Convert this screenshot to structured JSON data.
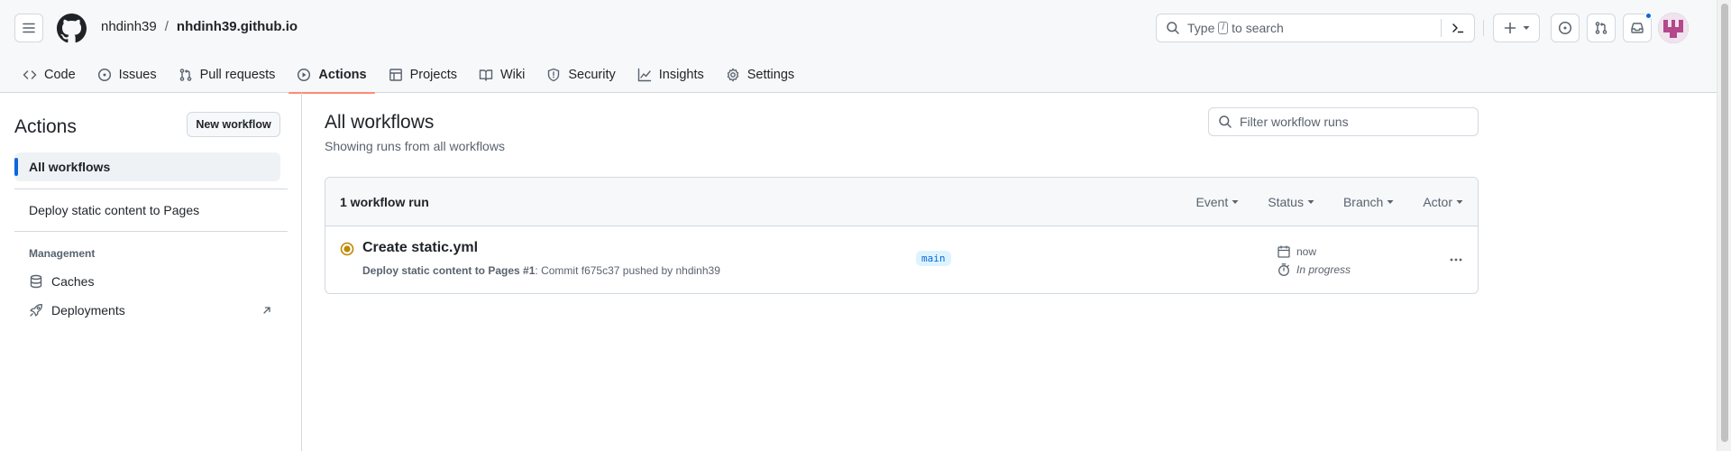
{
  "header": {
    "repo_owner": "nhdinh39",
    "repo_separator": "/",
    "repo_name": "nhdinh39.github.io",
    "search_prefix": "Type",
    "search_key": "/",
    "search_suffix": "to search"
  },
  "tabs": [
    {
      "label": "Code",
      "icon": "code-icon"
    },
    {
      "label": "Issues",
      "icon": "issue-opened-icon"
    },
    {
      "label": "Pull requests",
      "icon": "git-pull-request-icon"
    },
    {
      "label": "Actions",
      "icon": "play-icon",
      "active": true
    },
    {
      "label": "Projects",
      "icon": "table-icon"
    },
    {
      "label": "Wiki",
      "icon": "book-icon"
    },
    {
      "label": "Security",
      "icon": "shield-icon"
    },
    {
      "label": "Insights",
      "icon": "graph-icon"
    },
    {
      "label": "Settings",
      "icon": "gear-icon"
    }
  ],
  "sidebar": {
    "title": "Actions",
    "new_workflow": "New workflow",
    "items": [
      {
        "label": "All workflows",
        "active": true
      },
      {
        "label": "Deploy static content to Pages"
      }
    ],
    "management_heading": "Management",
    "links": [
      {
        "label": "Caches",
        "icon": "database-icon"
      },
      {
        "label": "Deployments",
        "icon": "rocket-icon",
        "external": true
      }
    ]
  },
  "main": {
    "title": "All workflows",
    "subtitle": "Showing runs from all workflows",
    "filter_placeholder": "Filter workflow runs",
    "runs_count": "1 workflow run",
    "filters": [
      "Event",
      "Status",
      "Branch",
      "Actor"
    ],
    "run": {
      "title": "Create static.yml",
      "workflow": "Deploy static content to Pages",
      "run_number": "#1",
      "meta_rest": ": Commit f675c37 pushed by nhdinh39",
      "branch": "main",
      "time": "now",
      "duration": "In progress",
      "status_color": "#bf8700"
    }
  },
  "colors": {
    "accent": "#0969da",
    "active_tab_underline": "#fd8c73",
    "avatar": "#b3488a"
  }
}
